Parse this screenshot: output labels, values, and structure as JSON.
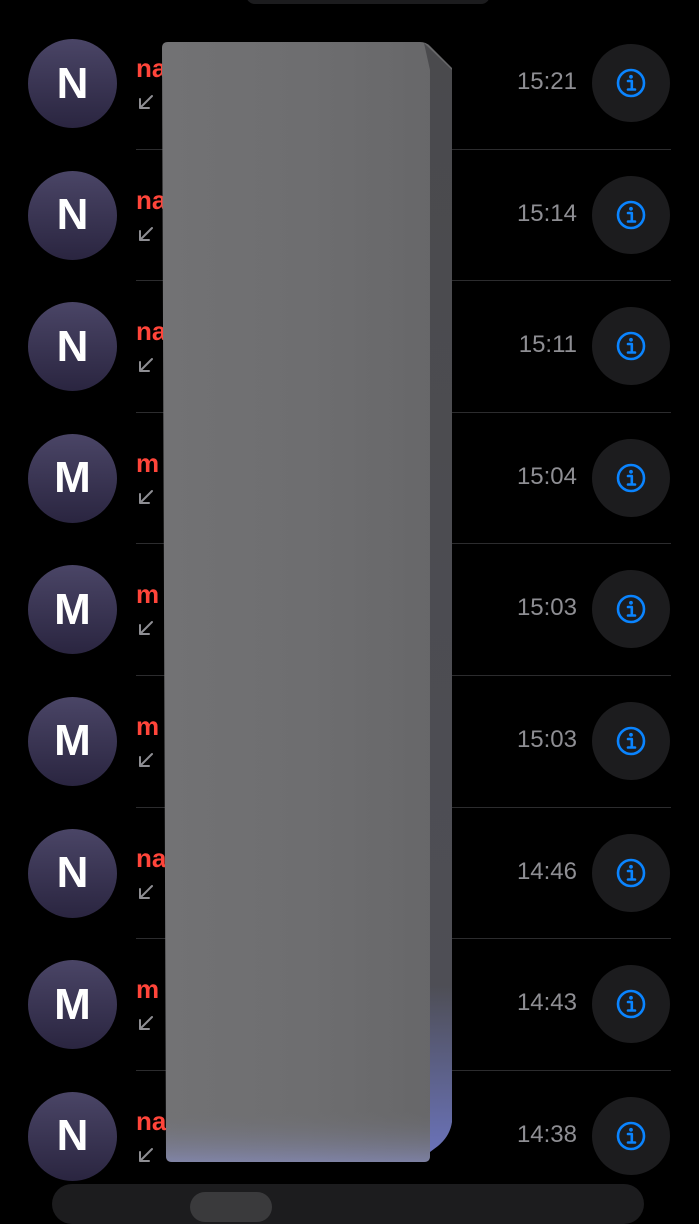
{
  "calls": [
    {
      "initial": "N",
      "name": "na",
      "time": "15:21"
    },
    {
      "initial": "N",
      "name": "na",
      "time": "15:14"
    },
    {
      "initial": "N",
      "name": "na",
      "time": "15:11"
    },
    {
      "initial": "M",
      "name": "m",
      "time": "15:04"
    },
    {
      "initial": "M",
      "name": "m",
      "time": "15:03"
    },
    {
      "initial": "M",
      "name": "m",
      "time": "15:03"
    },
    {
      "initial": "N",
      "name": "na",
      "time": "14:46"
    },
    {
      "initial": "M",
      "name": "m",
      "time": "14:43"
    },
    {
      "initial": "N",
      "name": "na",
      "time": "14:38"
    }
  ],
  "icons": {
    "call_direction": "incoming-call-arrow-icon",
    "info": "info-circle-icon"
  },
  "colors": {
    "background": "#000000",
    "missed_call_name": "#ff453a",
    "time_text": "#8e8e93",
    "info_accent": "#0a84ff",
    "avatar_bg": "#3d3858",
    "info_button_bg": "#1c1c1e",
    "redaction_block": "#6f6f71"
  }
}
